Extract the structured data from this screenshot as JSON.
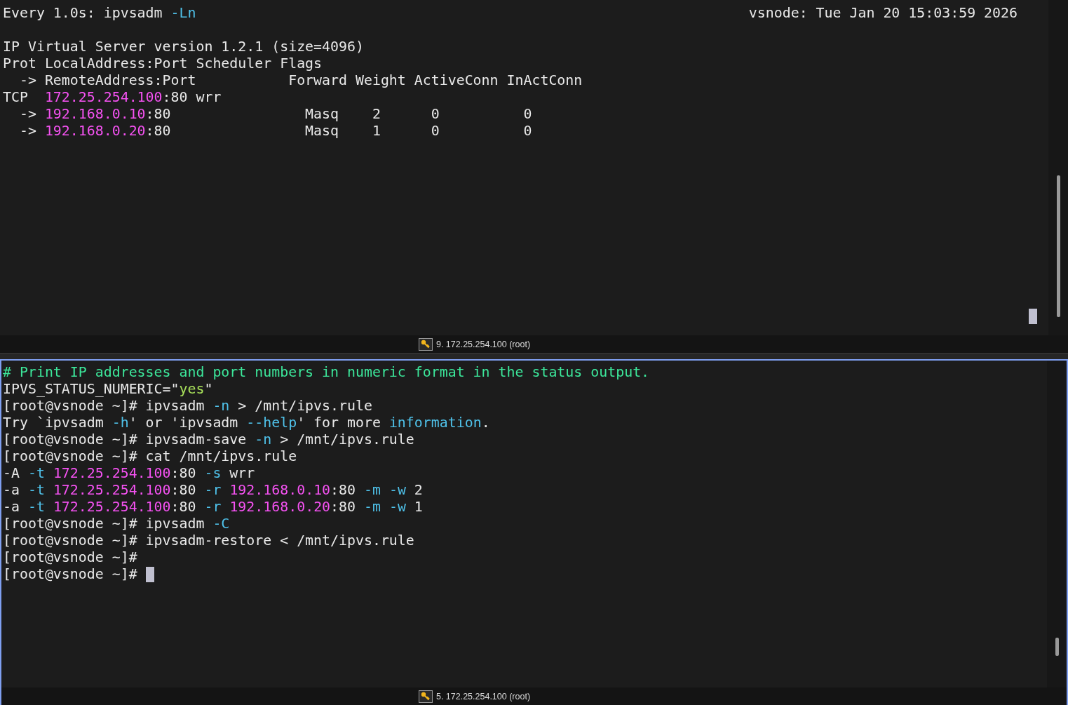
{
  "panes": [
    {
      "active": false,
      "cursor": true,
      "header": {
        "command": [
          {
            "kind": "plain",
            "text": "Every 1.0s: ipvsadm "
          },
          {
            "kind": "opt",
            "text": "-Ln"
          }
        ],
        "host_time": "vsnode: Tue Jan 20 15:03:59 2026"
      },
      "lines": [
        {
          "segments": [
            {
              "kind": "plain",
              "text": "IP Virtual Server version 1.2.1 (size=4096)"
            }
          ]
        },
        {
          "segments": [
            {
              "kind": "plain",
              "text": "Prot LocalAddress:Port Scheduler Flags"
            }
          ]
        },
        {
          "segments": [
            {
              "kind": "plain",
              "text": "  -> RemoteAddress:Port           Forward Weight ActiveConn InActConn"
            }
          ]
        },
        {
          "segments": [
            {
              "kind": "plain",
              "text": "TCP  "
            },
            {
              "kind": "addr",
              "text": "172.25.254.100"
            },
            {
              "kind": "plain",
              "text": ":80 wrr"
            }
          ]
        },
        {
          "segments": [
            {
              "kind": "plain",
              "text": "  -> "
            },
            {
              "kind": "addr",
              "text": "192.168.0.10"
            },
            {
              "kind": "plain",
              "text": ":80                Masq    2      0          0"
            }
          ]
        },
        {
          "segments": [
            {
              "kind": "plain",
              "text": "  -> "
            },
            {
              "kind": "addr",
              "text": "192.168.0.20"
            },
            {
              "kind": "plain",
              "text": ":80                Masq    1      0          0"
            }
          ]
        }
      ],
      "status": "9. 172.25.254.100 (root)"
    },
    {
      "active": true,
      "lines": [
        {
          "segments": [
            {
              "kind": "comment",
              "text": "# Print IP addresses and port numbers in numeric format in the status output."
            }
          ]
        },
        {
          "segments": [
            {
              "kind": "plain",
              "text": "IPVS_STATUS_NUMERIC=\""
            },
            {
              "kind": "string",
              "text": "yes"
            },
            {
              "kind": "plain",
              "text": "\""
            }
          ]
        },
        {
          "segments": [
            {
              "kind": "plain",
              "text": "[root@vsnode ~]# ipvsadm "
            },
            {
              "kind": "opt",
              "text": "-n"
            },
            {
              "kind": "plain",
              "text": " > /mnt/ipvs.rule"
            }
          ]
        },
        {
          "segments": [
            {
              "kind": "plain",
              "text": "Try `ipvsadm "
            },
            {
              "kind": "opt",
              "text": "-h"
            },
            {
              "kind": "plain",
              "text": "' or 'ipvsadm "
            },
            {
              "kind": "opt",
              "text": "--help"
            },
            {
              "kind": "plain",
              "text": "' for more "
            },
            {
              "kind": "opt",
              "text": "information"
            },
            {
              "kind": "plain",
              "text": "."
            }
          ]
        },
        {
          "segments": [
            {
              "kind": "plain",
              "text": "[root@vsnode ~]# ipvsadm-save "
            },
            {
              "kind": "opt",
              "text": "-n"
            },
            {
              "kind": "plain",
              "text": " > /mnt/ipvs.rule"
            }
          ]
        },
        {
          "segments": [
            {
              "kind": "plain",
              "text": "[root@vsnode ~]# cat /mnt/ipvs.rule"
            }
          ]
        },
        {
          "segments": [
            {
              "kind": "plain",
              "text": "-A "
            },
            {
              "kind": "opt",
              "text": "-t "
            },
            {
              "kind": "addr",
              "text": "172.25.254.100"
            },
            {
              "kind": "plain",
              "text": ":80 "
            },
            {
              "kind": "opt",
              "text": "-s"
            },
            {
              "kind": "plain",
              "text": " wrr"
            }
          ]
        },
        {
          "segments": [
            {
              "kind": "plain",
              "text": "-a "
            },
            {
              "kind": "opt",
              "text": "-t "
            },
            {
              "kind": "addr",
              "text": "172.25.254.100"
            },
            {
              "kind": "plain",
              "text": ":80 "
            },
            {
              "kind": "opt",
              "text": "-r "
            },
            {
              "kind": "addr",
              "text": "192.168.0.10"
            },
            {
              "kind": "plain",
              "text": ":80 "
            },
            {
              "kind": "opt",
              "text": "-m -w"
            },
            {
              "kind": "plain",
              "text": " 2"
            }
          ]
        },
        {
          "segments": [
            {
              "kind": "plain",
              "text": "-a "
            },
            {
              "kind": "opt",
              "text": "-t "
            },
            {
              "kind": "addr",
              "text": "172.25.254.100"
            },
            {
              "kind": "plain",
              "text": ":80 "
            },
            {
              "kind": "opt",
              "text": "-r "
            },
            {
              "kind": "addr",
              "text": "192.168.0.20"
            },
            {
              "kind": "plain",
              "text": ":80 "
            },
            {
              "kind": "opt",
              "text": "-m -w"
            },
            {
              "kind": "plain",
              "text": " 1"
            }
          ]
        },
        {
          "segments": [
            {
              "kind": "plain",
              "text": "[root@vsnode ~]# ipvsadm "
            },
            {
              "kind": "opt",
              "text": "-C"
            }
          ]
        },
        {
          "segments": [
            {
              "kind": "plain",
              "text": "[root@vsnode ~]# ipvsadm-restore < /mnt/ipvs.rule"
            }
          ]
        },
        {
          "segments": [
            {
              "kind": "plain",
              "text": "[root@vsnode ~]#"
            }
          ]
        },
        {
          "segments": [
            {
              "kind": "plain",
              "text": "[root@vsnode ~]# "
            }
          ],
          "cursor": true
        }
      ],
      "status": "5. 172.25.254.100 (root)"
    }
  ]
}
